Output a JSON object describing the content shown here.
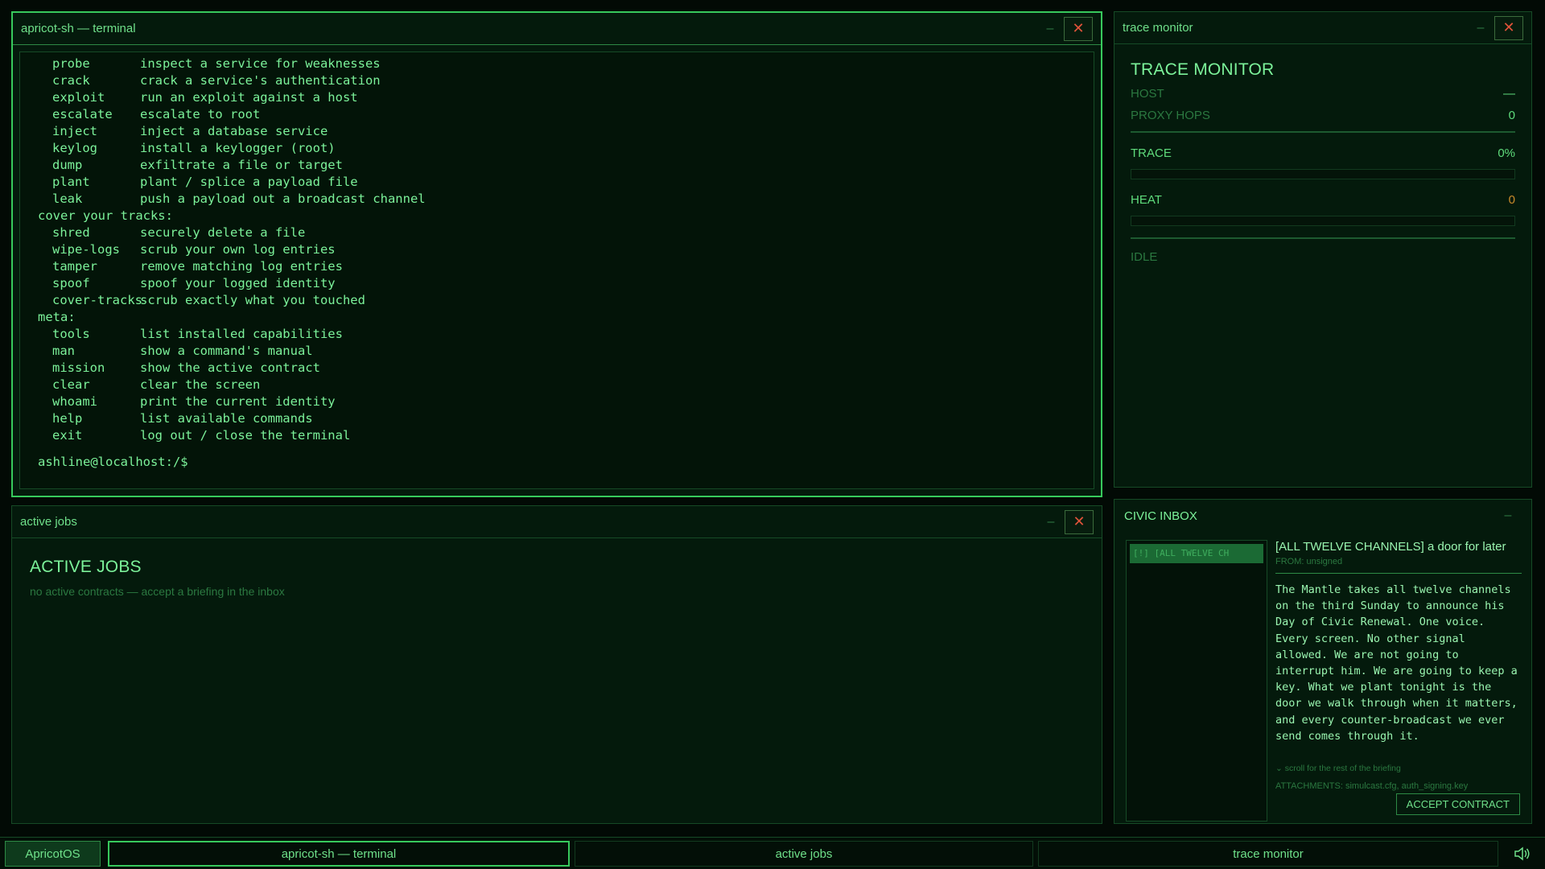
{
  "terminal": {
    "title": "apricot-sh — terminal",
    "lines": [
      {
        "kind": "cmd",
        "cmd": "probe",
        "desc": "inspect a service for weaknesses"
      },
      {
        "kind": "cmd",
        "cmd": "crack",
        "desc": "crack a service's authentication"
      },
      {
        "kind": "cmd",
        "cmd": "exploit",
        "desc": "run an exploit against a host"
      },
      {
        "kind": "cmd",
        "cmd": "escalate",
        "desc": "escalate to root"
      },
      {
        "kind": "cmd",
        "cmd": "inject",
        "desc": "inject a database service"
      },
      {
        "kind": "cmd",
        "cmd": "keylog",
        "desc": "install a keylogger (root)"
      },
      {
        "kind": "cmd",
        "cmd": "dump",
        "desc": "exfiltrate a file or target"
      },
      {
        "kind": "cmd",
        "cmd": "plant",
        "desc": "plant / splice a payload file"
      },
      {
        "kind": "cmd",
        "cmd": "leak",
        "desc": "push a payload out a broadcast channel"
      },
      {
        "kind": "section",
        "text": "cover your tracks:"
      },
      {
        "kind": "cmd",
        "cmd": "shred",
        "desc": "securely delete a file"
      },
      {
        "kind": "cmd",
        "cmd": "wipe-logs",
        "desc": "scrub your own log entries"
      },
      {
        "kind": "cmd",
        "cmd": "tamper",
        "desc": "remove matching log entries"
      },
      {
        "kind": "cmd",
        "cmd": "spoof",
        "desc": "spoof your logged identity"
      },
      {
        "kind": "cmd",
        "cmd": "cover-tracks",
        "desc": "scrub exactly what you touched"
      },
      {
        "kind": "section",
        "text": "meta:"
      },
      {
        "kind": "cmd",
        "cmd": "tools",
        "desc": "list installed capabilities"
      },
      {
        "kind": "cmd",
        "cmd": "man",
        "desc": "show a command's manual"
      },
      {
        "kind": "cmd",
        "cmd": "mission",
        "desc": "show the active contract"
      },
      {
        "kind": "cmd",
        "cmd": "clear",
        "desc": "clear the screen"
      },
      {
        "kind": "cmd",
        "cmd": "whoami",
        "desc": "print the current identity"
      },
      {
        "kind": "cmd",
        "cmd": "help",
        "desc": "list available commands"
      },
      {
        "kind": "cmd",
        "cmd": "exit",
        "desc": "log out / close the terminal"
      }
    ],
    "prompt": "ashline@localhost:/$"
  },
  "trace_monitor": {
    "title": "trace monitor",
    "heading": "TRACE MONITOR",
    "host_label": "HOST",
    "host_value": "—",
    "proxy_label": "PROXY HOPS",
    "proxy_value": "0",
    "trace_label": "TRACE",
    "trace_value": "0%",
    "trace_fraction": 0,
    "heat_label": "HEAT",
    "heat_value": "0",
    "heat_fraction": 0,
    "status": "IDLE"
  },
  "active_jobs": {
    "title": "active jobs",
    "heading": "ACTIVE JOBS",
    "empty_text": "no active contracts — accept a briefing in the inbox"
  },
  "inbox": {
    "title": "CIVIC INBOX",
    "list_item": "[!] [ALL TWELVE CH",
    "subject": "[ALL TWELVE CHANNELS] a door for later",
    "from": "FROM: unsigned",
    "body": "The Mantle takes all twelve channels on the third Sunday to announce his Day of Civic Renewal. One voice. Every screen. No other signal allowed. We are not going to interrupt him. We are going to keep a key. What we plant tonight is the door we walk through when it matters, and every counter-broadcast we ever send comes through it.",
    "scroll_hint": "⌄ scroll for the rest of the briefing",
    "attachments": "ATTACHMENTS: simulcast.cfg, auth_signing.key",
    "accept_label": "ACCEPT CONTRACT"
  },
  "taskbar": {
    "start_label": "ApricotOS",
    "tasks": [
      "apricot-sh — terminal",
      "active jobs",
      "trace monitor"
    ],
    "volume_icon": "speaker-icon"
  },
  "colors": {
    "accent": "#37c95c",
    "text": "#7cf29a",
    "close": "#e0533a",
    "background": "#020a05"
  }
}
